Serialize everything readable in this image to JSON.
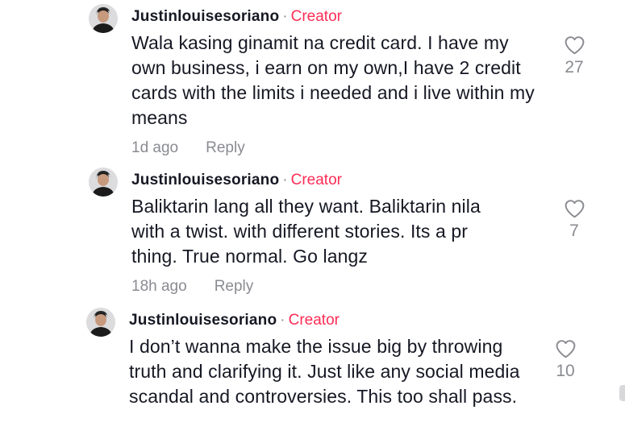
{
  "comments": [
    {
      "username": "Justinlouisesoriano",
      "badge": "Creator",
      "text": "Wala kasing ginamit na credit card. I have my own business, i earn on my own,I have 2 credit cards with the limits i needed and i live within my means",
      "time": "1d ago",
      "reply_label": "Reply",
      "likes": "27"
    },
    {
      "username": "Justinlouisesoriano",
      "badge": "Creator",
      "text": "Baliktarin lang all they want. Baliktarin nila with a twist. with different stories. Its a pr thing. True normal. Go langz",
      "time": "18h ago",
      "reply_label": "Reply",
      "likes": "7"
    },
    {
      "username": "Justinlouisesoriano",
      "badge": "Creator",
      "text": "I don’t wanna make the issue big by throwing truth and clarifying it. Just like any social media scandal and controversies. This too shall pass.",
      "time": "",
      "reply_label": "",
      "likes": "10"
    }
  ],
  "separator": "·",
  "icons": {
    "like": "heart-outline-icon",
    "avatar": "user-avatar"
  },
  "colors": {
    "creator": "#fe2c55",
    "muted": "#8a8b91",
    "text": "#161823"
  }
}
